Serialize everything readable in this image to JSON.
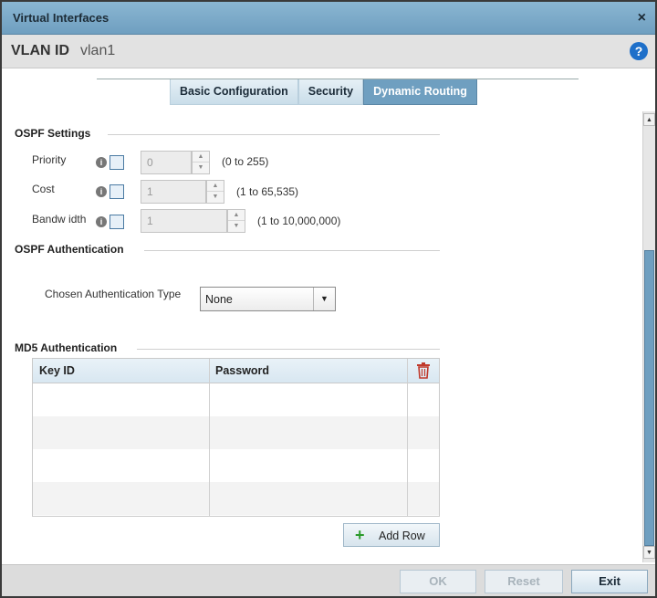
{
  "window": {
    "title": "Virtual Interfaces",
    "close_glyph": "×"
  },
  "header": {
    "vlan_label": "VLAN ID",
    "vlan_value": "vlan1",
    "help_glyph": "?"
  },
  "tabs": [
    {
      "label": "Basic Configuration",
      "active": false
    },
    {
      "label": "Security",
      "active": false
    },
    {
      "label": "Dynamic Routing",
      "active": true
    }
  ],
  "ospf_settings": {
    "title": "OSPF Settings",
    "fields": [
      {
        "label": "Priority",
        "value": "0",
        "range": "(0 to 255)"
      },
      {
        "label": "Cost",
        "value": "1",
        "range": "(1 to 65,535)"
      },
      {
        "label": "Bandw idth",
        "value": "1",
        "range": "(1 to 10,000,000)"
      }
    ]
  },
  "ospf_auth": {
    "title": "OSPF Authentication",
    "type_label": "Chosen Authentication Type",
    "type_value": "None"
  },
  "md5_auth": {
    "title": "MD5 Authentication",
    "columns": [
      "Key ID",
      "Password"
    ],
    "rows": [],
    "add_row_label": "Add Row"
  },
  "footer": {
    "ok_label": "OK",
    "reset_label": "Reset",
    "exit_label": "Exit"
  },
  "colors": {
    "accent": "#6f9fc0",
    "help": "#1e6fc9",
    "trash": "#c0392b",
    "add": "#2a9a2a"
  }
}
